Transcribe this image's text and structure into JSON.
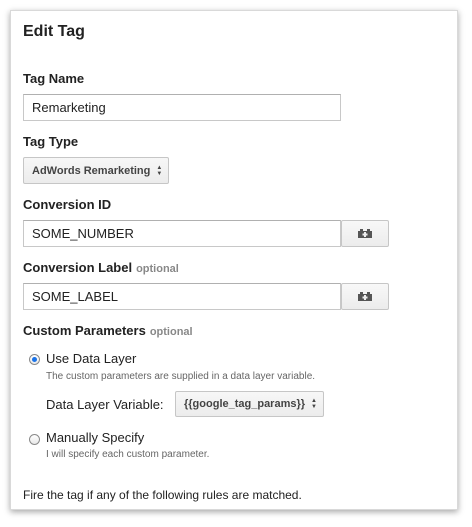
{
  "dialog": {
    "title": "Edit Tag"
  },
  "tag_name": {
    "label": "Tag Name",
    "value": "Remarketing"
  },
  "tag_type": {
    "label": "Tag Type",
    "selected": "AdWords Remarketing"
  },
  "conversion_id": {
    "label": "Conversion ID",
    "value": "SOME_NUMBER",
    "macro_icon": "macro-icon"
  },
  "conversion_label": {
    "label": "Conversion Label",
    "optional": "optional",
    "value": "SOME_LABEL",
    "macro_icon": "macro-icon"
  },
  "custom_parameters": {
    "label": "Custom Parameters",
    "optional": "optional",
    "options": [
      {
        "label": "Use Data Layer",
        "description": "The custom parameters are supplied in a data layer variable.",
        "checked": true
      },
      {
        "label": "Manually Specify",
        "description": "I will specify each custom parameter.",
        "checked": false
      }
    ],
    "data_layer_variable": {
      "label": "Data Layer Variable:",
      "selected": "{{google_tag_params}}"
    }
  },
  "rules_text": "Fire the tag if any of the following rules are matched.",
  "colors": {
    "radio_accent": "#1a73e8",
    "optional_text": "#888888"
  }
}
